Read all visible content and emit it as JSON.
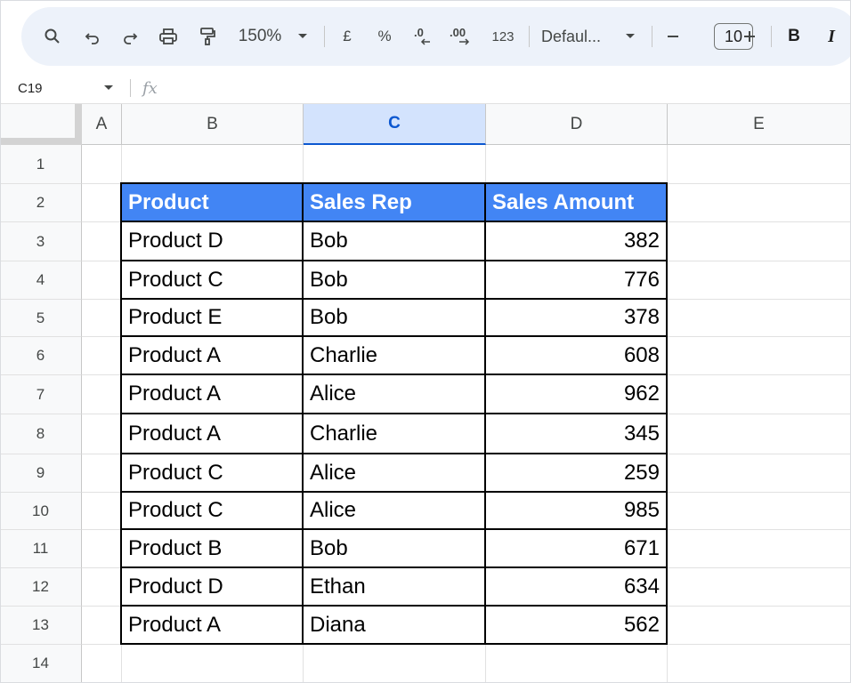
{
  "toolbar": {
    "zoom": "150%",
    "currency": "£",
    "percent": "%",
    "number_format": "123",
    "font_name": "Defaul...",
    "font_size": "10",
    "bold": "B",
    "italic": "I"
  },
  "formula_bar": {
    "name_box": "C19",
    "fx": "fx",
    "content": ""
  },
  "grid": {
    "columns": [
      "A",
      "B",
      "C",
      "D",
      "E"
    ],
    "selected_column": "C",
    "rows": [
      "1",
      "2",
      "3",
      "4",
      "5",
      "6",
      "7",
      "8",
      "9",
      "10",
      "11",
      "12",
      "13",
      "14"
    ]
  },
  "table": {
    "headers": [
      "Product",
      "Sales Rep",
      "Sales Amount"
    ],
    "header_color": "#4285f4",
    "rows": [
      [
        "Product D",
        "Bob",
        "382"
      ],
      [
        "Product C",
        "Bob",
        "776"
      ],
      [
        "Product E",
        "Bob",
        "378"
      ],
      [
        "Product A",
        "Charlie",
        "608"
      ],
      [
        "Product A",
        "Alice",
        "962"
      ],
      [
        "Product A",
        "Charlie",
        "345"
      ],
      [
        "Product C",
        "Alice",
        "259"
      ],
      [
        "Product C",
        "Alice",
        "985"
      ],
      [
        "Product B",
        "Bob",
        "671"
      ],
      [
        "Product D",
        "Ethan",
        "634"
      ],
      [
        "Product A",
        "Diana",
        "562"
      ]
    ]
  },
  "colors": {
    "toolbar_bg": "#edf2fa",
    "selected_col_bg": "#d3e3fd",
    "selected_col_text": "#0b57d0",
    "table_header_bg": "#4285f4"
  }
}
